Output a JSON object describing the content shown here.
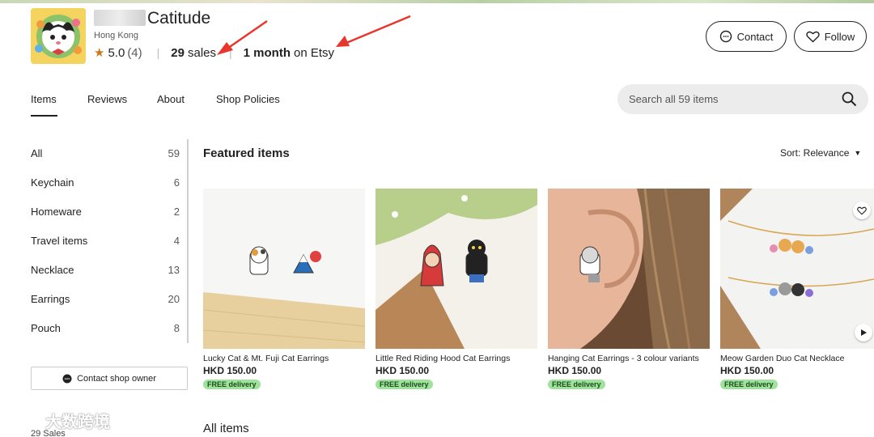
{
  "shop": {
    "name_visible": "Catitude",
    "location": "Hong Kong",
    "rating": "5.0",
    "rating_count": "(4)",
    "sales_num": "29",
    "sales_word": "sales",
    "tenure_num": "1 month",
    "tenure_word": "on Etsy",
    "contact_label": "Contact",
    "follow_label": "Follow"
  },
  "tabs": [
    "Items",
    "Reviews",
    "About",
    "Shop Policies"
  ],
  "search": {
    "placeholder": "Search all 59 items"
  },
  "sidebar": {
    "items": [
      {
        "label": "All",
        "count": "59"
      },
      {
        "label": "Keychain",
        "count": "6"
      },
      {
        "label": "Homeware",
        "count": "2"
      },
      {
        "label": "Travel items",
        "count": "4"
      },
      {
        "label": "Necklace",
        "count": "13"
      },
      {
        "label": "Earrings",
        "count": "20"
      },
      {
        "label": "Pouch",
        "count": "8"
      }
    ],
    "contact_owner_label": "Contact shop owner",
    "sales_footer": "29 Sales"
  },
  "main": {
    "featured_title": "Featured items",
    "sort_label": "Sort: Relevance",
    "all_items_title": "All items",
    "cards": [
      {
        "title": "Lucky Cat & Mt. Fuji Cat Earrings",
        "price": "HKD 150.00",
        "badge": "FREE delivery"
      },
      {
        "title": "Little Red Riding Hood Cat Earrings",
        "price": "HKD 150.00",
        "badge": "FREE delivery"
      },
      {
        "title": "Hanging Cat Earrings - 3 colour variants",
        "price": "HKD 150.00",
        "badge": "FREE delivery"
      },
      {
        "title": "Meow Garden Duo Cat Necklace",
        "price": "HKD 150.00",
        "badge": "FREE delivery"
      }
    ]
  },
  "watermark": "大数跨境",
  "colors": {
    "accent_dark": "#222222",
    "badge_green": "#9ee29b",
    "annotation_red": "#e8362d",
    "star": "#c97a16"
  }
}
